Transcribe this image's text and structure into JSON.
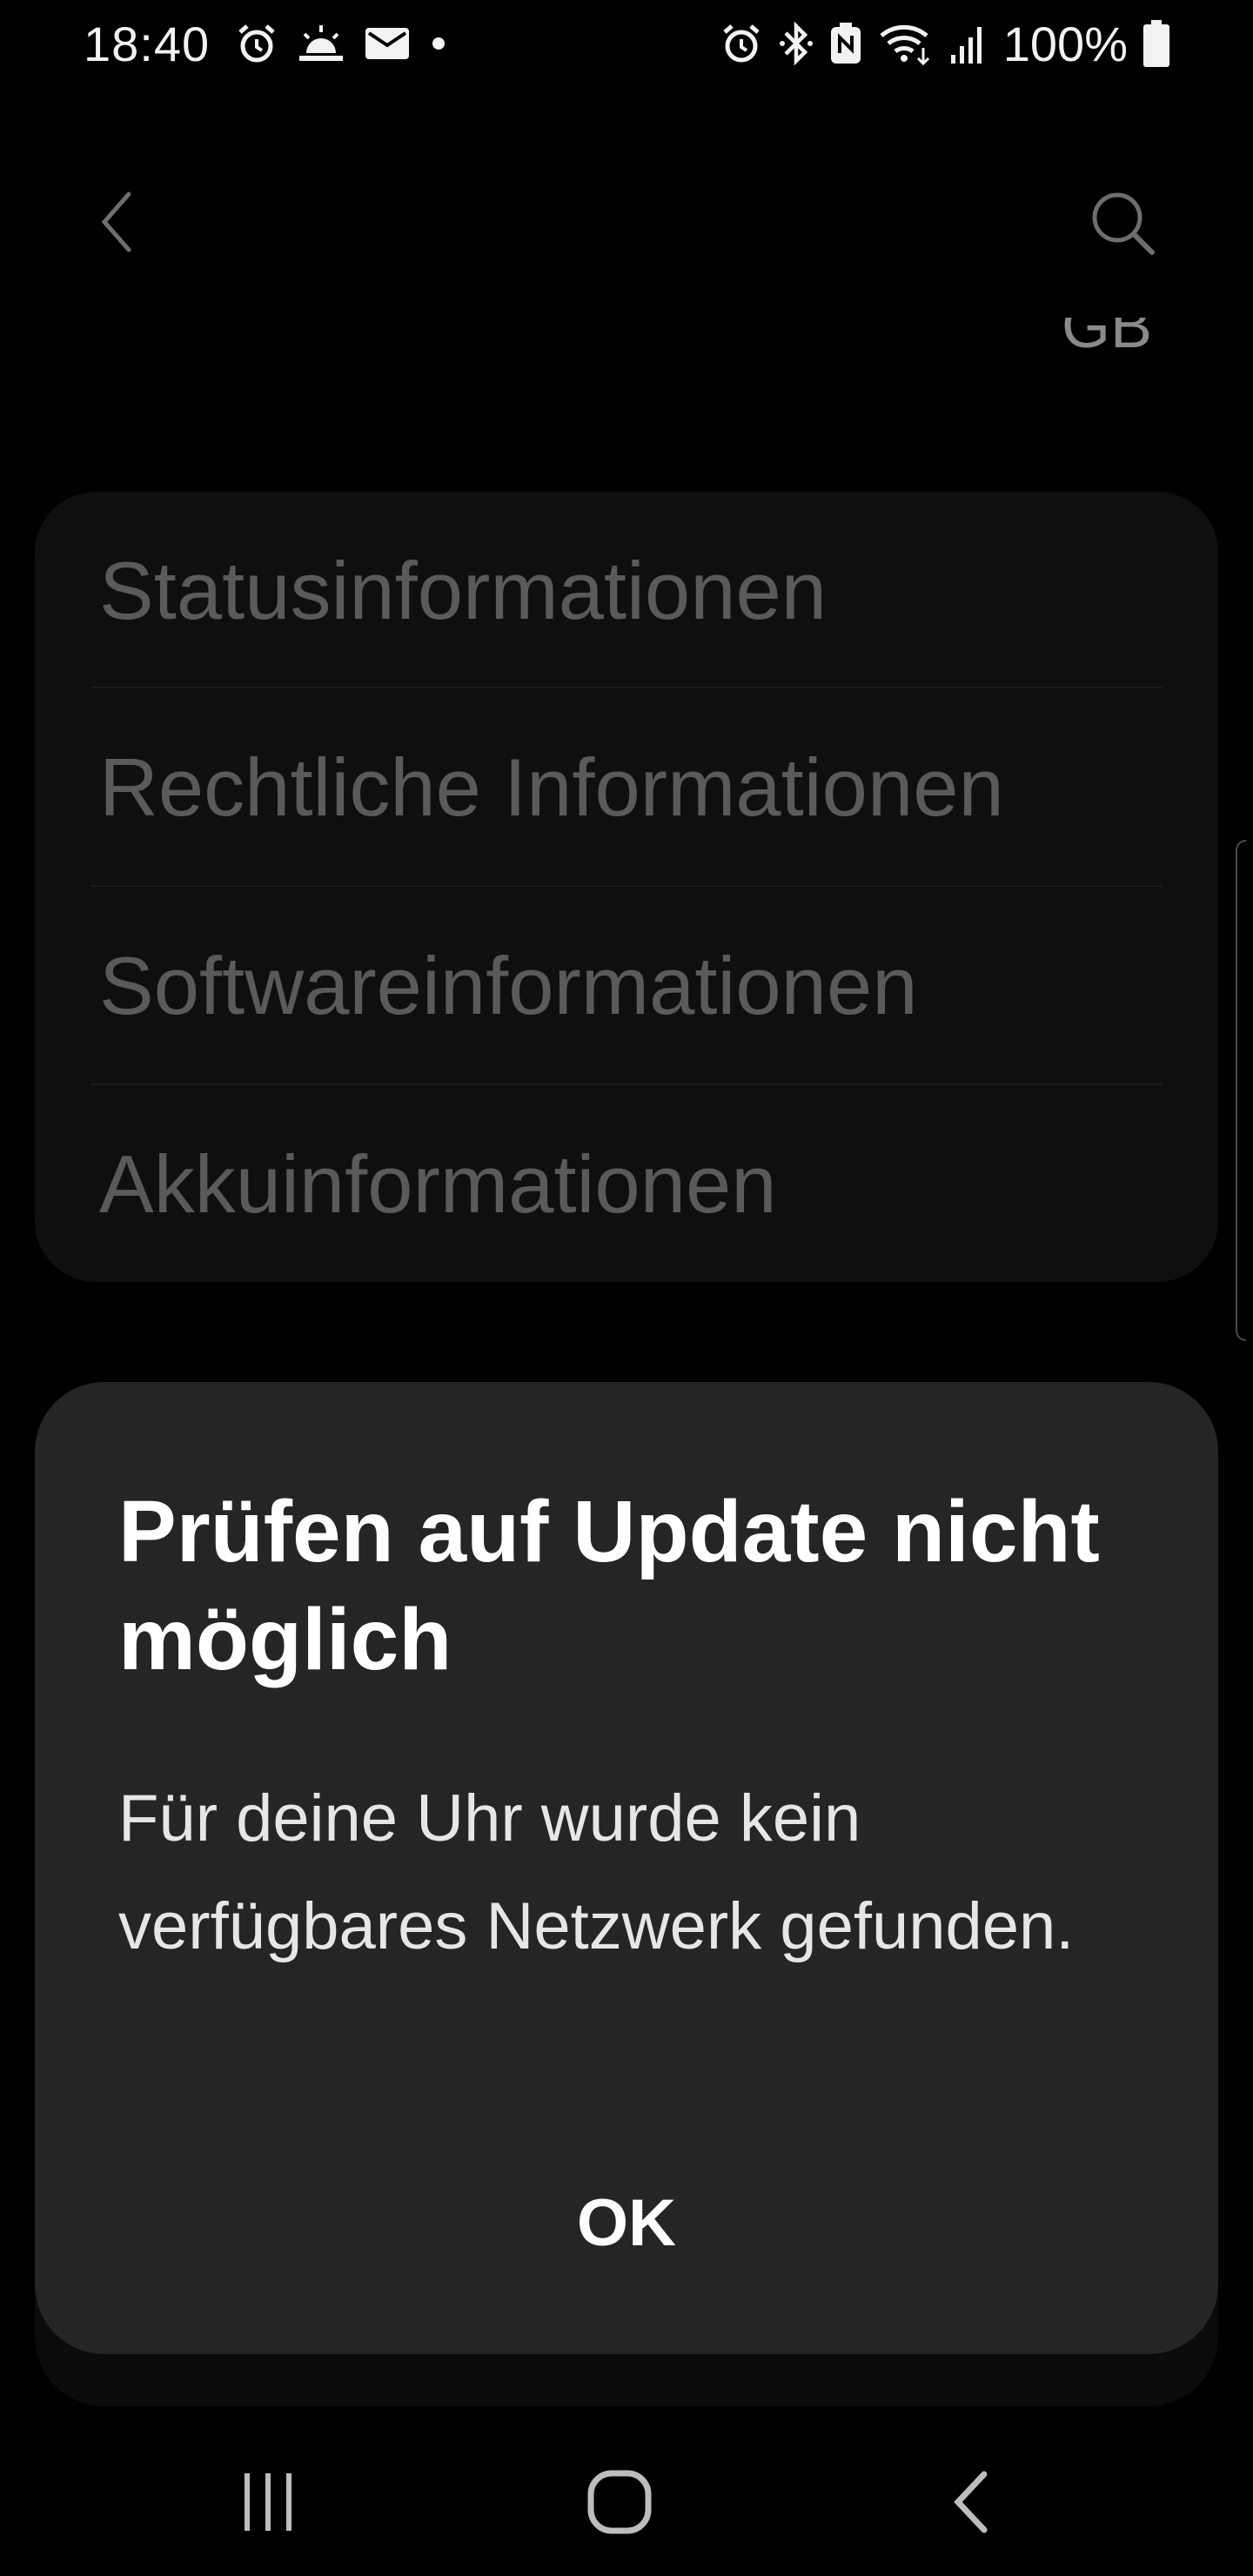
{
  "status_bar": {
    "time": "18:40",
    "battery_percent": "100%",
    "left_icons": [
      "alarm-icon",
      "sunrise-icon",
      "email-icon",
      "dot-icon"
    ],
    "right_icons": [
      "alarm-icon",
      "bluetooth-icon",
      "nfc-icon",
      "wifi-icon",
      "signal-icon",
      "battery-icon"
    ]
  },
  "app_bar": {
    "back_icon": "back-chevron-icon",
    "search_icon": "search-icon",
    "storage_unit_peek": "GB"
  },
  "info_list": {
    "items": [
      {
        "label": "Statusinformationen"
      },
      {
        "label": "Rechtliche Informationen"
      },
      {
        "label": "Softwareinformationen"
      },
      {
        "label": "Akkuinformationen"
      }
    ]
  },
  "dialog": {
    "title": "Prüfen auf Update nicht möglich",
    "message": "Für deine Uhr wurde kein verfügbares Netzwerk gefunden.",
    "ok_label": "OK"
  },
  "nav_bar": {
    "icons": [
      "recents-icon",
      "home-icon",
      "back-icon"
    ]
  },
  "colors": {
    "background": "#000000",
    "card": "#0f0f10",
    "dialog": "#252527",
    "dimmed_text": "#5a5a5a"
  }
}
